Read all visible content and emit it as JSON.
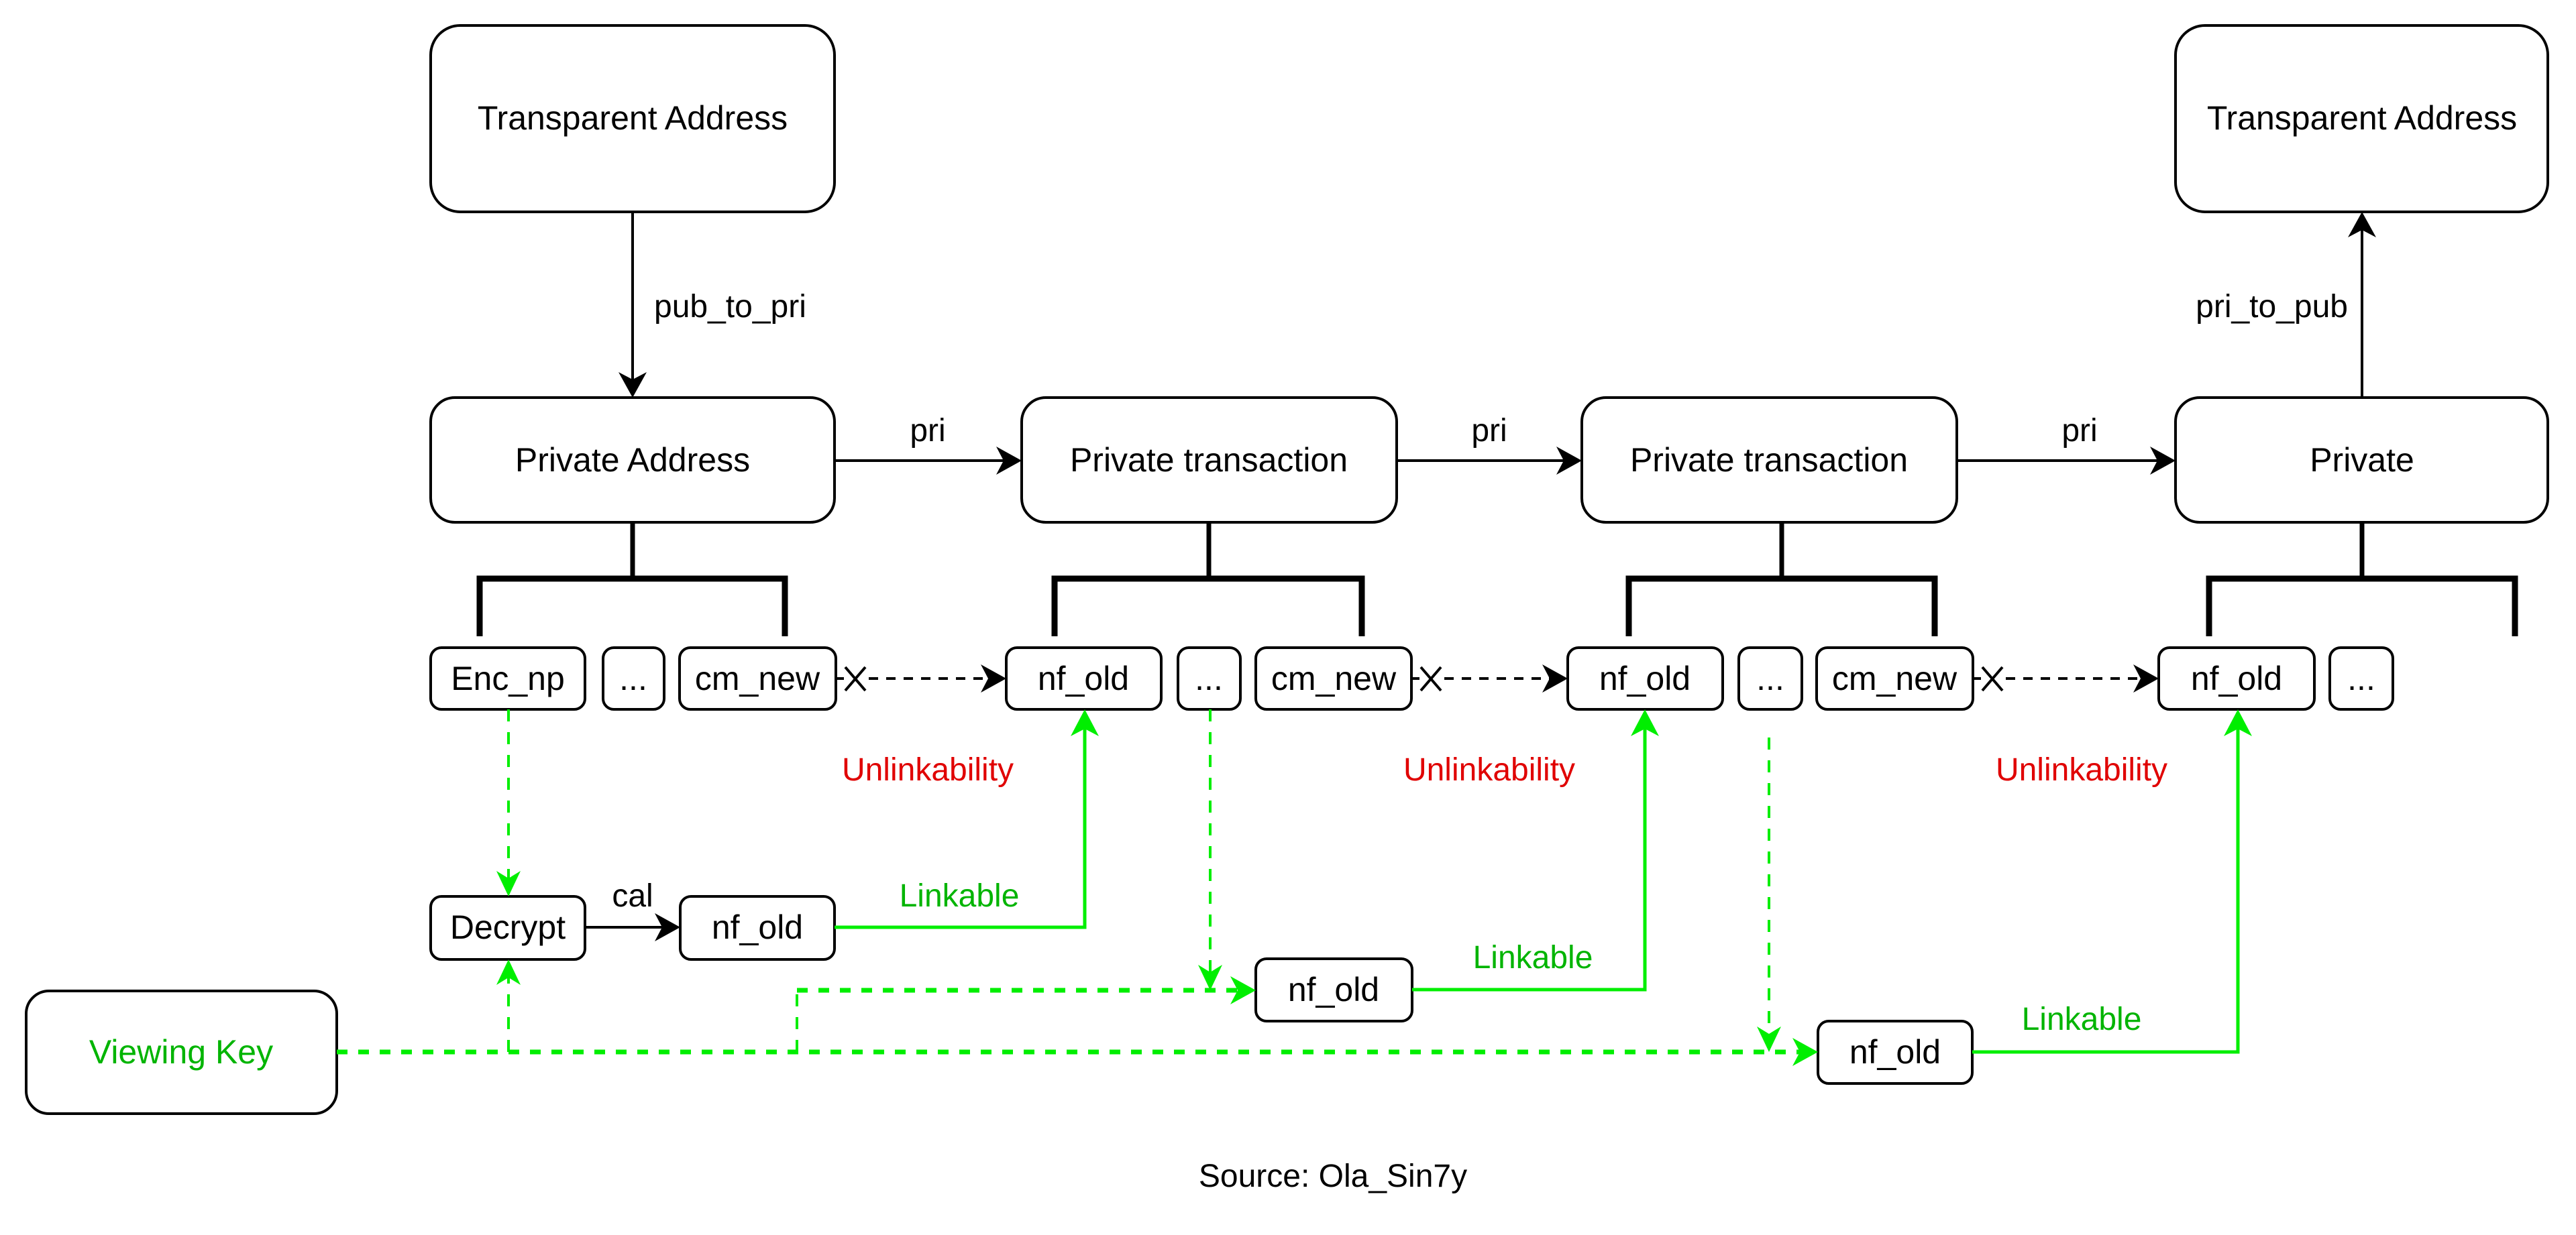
{
  "diagram": {
    "nodes": {
      "transparent_address_left": "Transparent Address",
      "transparent_address_right": "Transparent Address",
      "private_address": "Private Address",
      "private_transaction_1": "Private transaction",
      "private_transaction_2": "Private transaction",
      "private_final": "Private",
      "viewing_key": "Viewing Key"
    },
    "fields": {
      "private_address": [
        "Enc_np",
        "...",
        "cm_new"
      ],
      "private_transaction_1": [
        "nf_old",
        "...",
        "cm_new"
      ],
      "private_transaction_2": [
        "nf_old",
        "...",
        "cm_new"
      ],
      "private_final": [
        "nf_old",
        "..."
      ]
    },
    "derived": {
      "decrypt": "Decrypt",
      "nf_old_1": "nf_old",
      "nf_old_2": "nf_old",
      "nf_old_3": "nf_old"
    },
    "edge_labels": {
      "pub_to_pri": "pub_to_pri",
      "pri_1": "pri",
      "pri_2": "pri",
      "pri_3": "pri",
      "pri_to_pub": "pri_to_pub",
      "cal": "cal"
    },
    "annotations": {
      "unlinkability_1": "Unlinkability",
      "unlinkability_2": "Unlinkability",
      "unlinkability_3": "Unlinkability",
      "linkable_1": "Linkable",
      "linkable_2": "Linkable",
      "linkable_3": "Linkable"
    },
    "source": "Source: Ola_Sin7y",
    "colors": {
      "unlinkability": "#e00000",
      "linkable_text": "#00b400",
      "viewing_key_line": "#00ee00",
      "default": "#000000"
    }
  }
}
